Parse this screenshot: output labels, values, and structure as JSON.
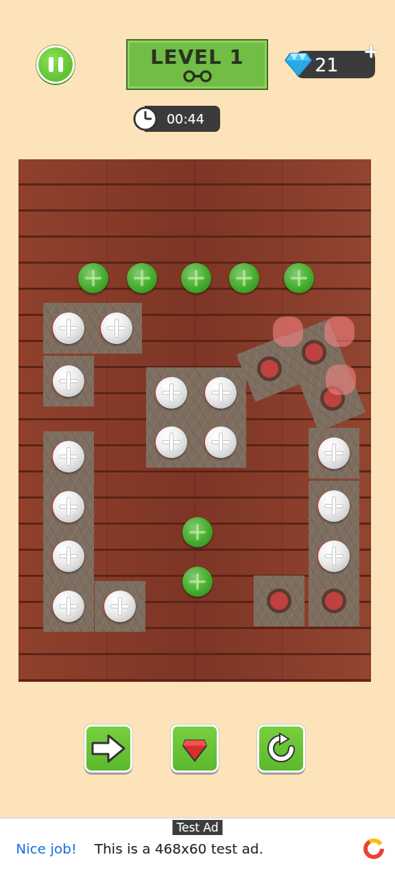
{
  "header": {
    "level": "LEVEL 1",
    "gems": "21",
    "add": "+",
    "timer": "00:44"
  },
  "board": {
    "loose_screws": [
      {
        "color": "#43ad2b"
      },
      {
        "color": "#43ad2b"
      },
      {
        "color": "#43ad2b"
      },
      {
        "color": "#43ad2b"
      },
      {
        "color": "#43ad2b"
      },
      {
        "color": "#43ad2b"
      },
      {
        "color": "#43ad2b"
      }
    ],
    "plates": [
      {
        "holes": [
          {
            "screwed": true
          },
          {
            "screwed": true
          },
          {
            "screwed": true
          }
        ]
      },
      {
        "holes": [
          {
            "screwed": true
          },
          {
            "screwed": true
          },
          {
            "screwed": true
          },
          {
            "screwed": true
          }
        ]
      },
      {
        "holes": [
          {
            "screwed": false
          },
          {
            "screwed": false
          },
          {
            "screwed": false
          }
        ]
      },
      {
        "holes": [
          {
            "screwed": true
          },
          {
            "screwed": true
          },
          {
            "screwed": true
          },
          {
            "screwed": true
          },
          {
            "screwed": true
          }
        ]
      },
      {
        "holes": [
          {
            "screwed": true
          },
          {
            "screwed": true
          },
          {
            "screwed": true
          },
          {
            "screwed": false
          },
          {
            "screwed": false
          }
        ]
      }
    ]
  },
  "ad": {
    "label": "Test Ad",
    "headline": "Nice job!",
    "text": "This is a 468x60 test ad."
  }
}
